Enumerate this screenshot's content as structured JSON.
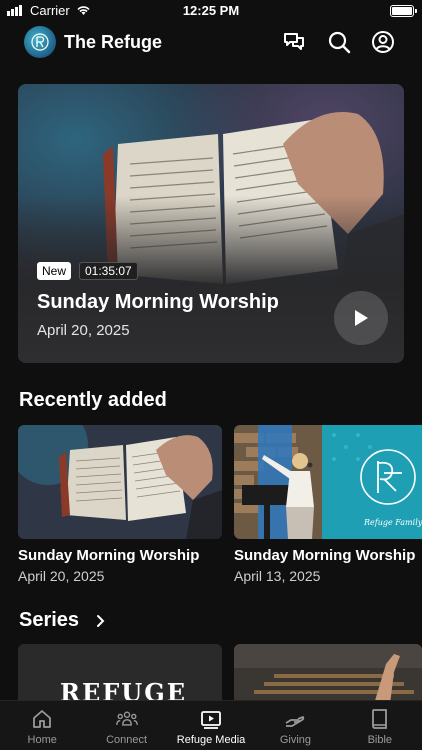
{
  "status": {
    "carrier": "Carrier",
    "time": "12:25 PM"
  },
  "header": {
    "title": "The Refuge",
    "icons": [
      "chat-icon",
      "search-icon",
      "account-icon"
    ]
  },
  "hero": {
    "badge": "New",
    "duration": "01:35:07",
    "title": "Sunday Morning Worship",
    "date": "April 20, 2025"
  },
  "recent": {
    "title": "Recently added",
    "items": [
      {
        "title": "Sunday Morning Worship",
        "date": "April 20, 2025"
      },
      {
        "title": "Sunday Morning Worship",
        "date": "April 13, 2025"
      }
    ]
  },
  "series": {
    "title": "Series",
    "first_card_text": "REFUGE"
  },
  "tabs": [
    {
      "label": "Home",
      "icon": "home-icon"
    },
    {
      "label": "Connect",
      "icon": "people-icon"
    },
    {
      "label": "Refuge Media",
      "icon": "media-play-icon"
    },
    {
      "label": "Giving",
      "icon": "giving-hand-icon"
    },
    {
      "label": "Bible",
      "icon": "book-icon"
    }
  ],
  "colors": {
    "background": "#0f0f0f",
    "accent": "#3fb6c8",
    "tab_inactive": "#9a9a9a"
  }
}
